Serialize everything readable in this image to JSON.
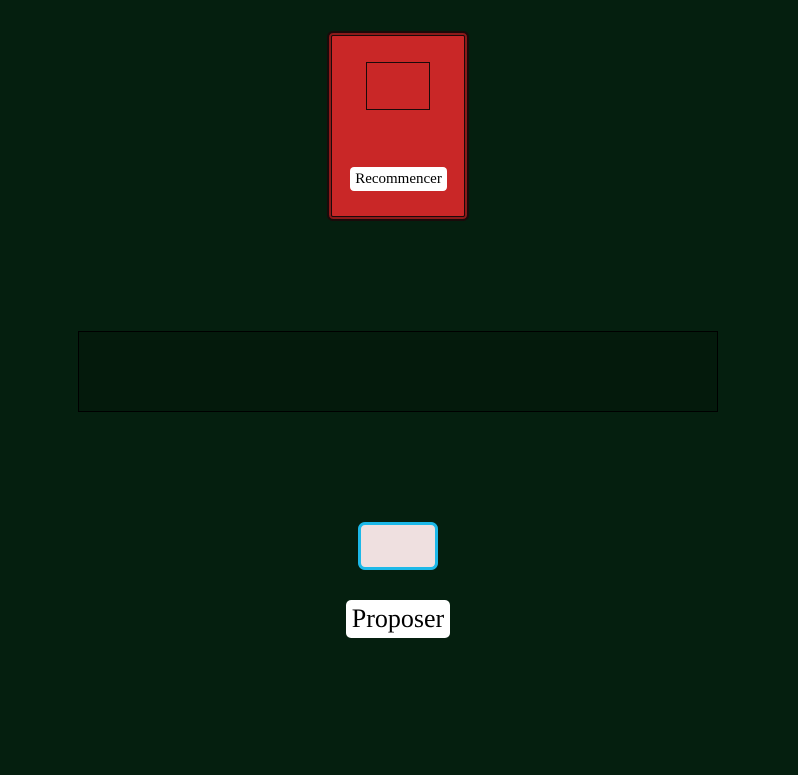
{
  "deck": {
    "restart_label": "Recommencer"
  },
  "hand": {
    "cards": []
  },
  "guess": {
    "value": "",
    "placeholder": ""
  },
  "actions": {
    "propose_label": "Proposer"
  },
  "colors": {
    "background": "#051f0f",
    "deck": "#c92727",
    "input_border": "#1cb8e8",
    "input_fill": "#efe0e0"
  }
}
